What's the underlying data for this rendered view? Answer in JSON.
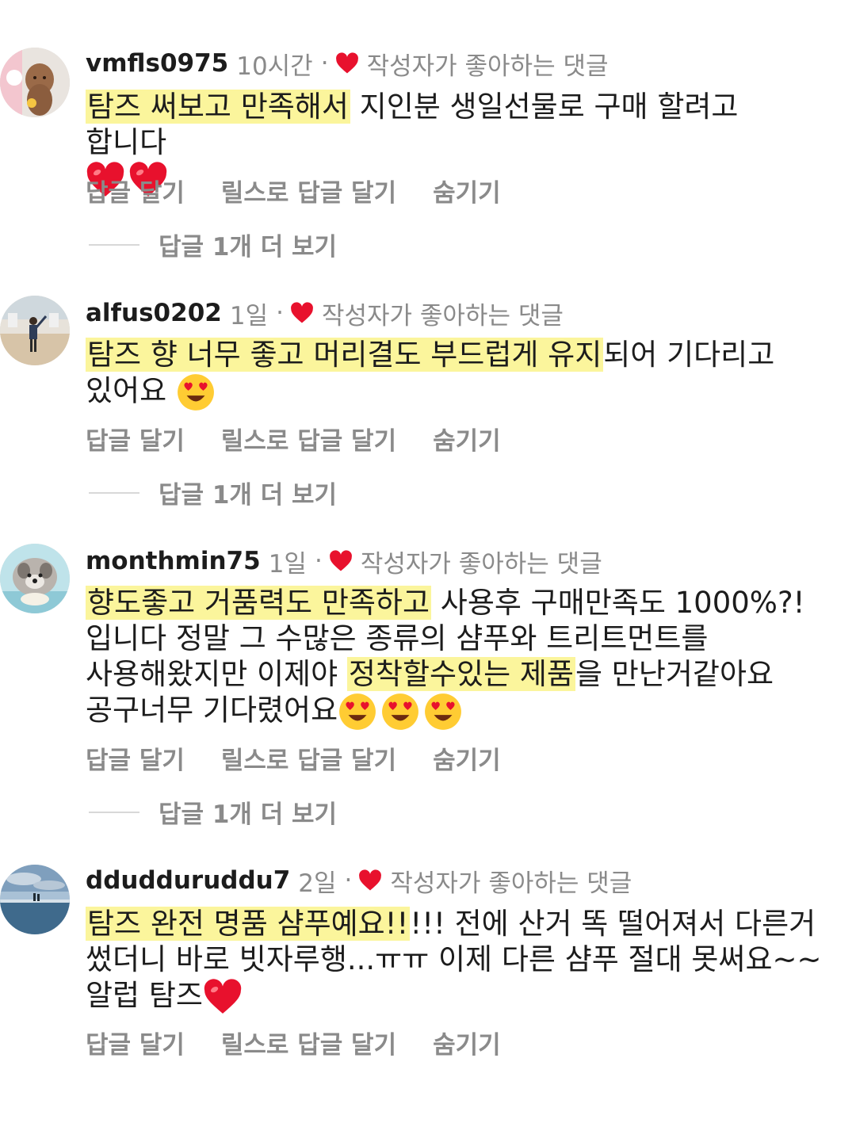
{
  "liked_label": "작성자가 좋아하는 댓글",
  "action_labels": {
    "reply": "답글 달기",
    "reels_reply": "릴스로 답글 달기",
    "hide": "숨기기"
  },
  "highlight_color": "#fbf59c",
  "heart_color": "#e8112d",
  "comments": [
    {
      "username": "vmfls0975",
      "time": "10시간",
      "avatar_icon": "poodle-photo-avatar",
      "text_highlight": "탐즈 써보고 만족해서",
      "text_rest": " 지인분 생일선물로 구매 할려고 합니다",
      "emoji": [
        "red-heart",
        "red-heart"
      ],
      "more_replies": "답글 1개 더 보기"
    },
    {
      "username": "alfus0202",
      "time": "1일",
      "avatar_icon": "gym-photo-avatar",
      "text_highlight": "탐즈 향 너무 좋고 머리결도 부드럽게 유지",
      "text_rest": "되어 기다리고 있어요",
      "emoji": [
        "heart-eyes"
      ],
      "more_replies": "답글 1개 더 보기"
    },
    {
      "username": "monthmin75",
      "time": "1일",
      "avatar_icon": "dog-photo-avatar",
      "text_highlight": "향도좋고 거품력도 만족하고",
      "text_mid": " 사용후 구매만족도 1000%?!입니다 정말 그 수많은 종류의 샴푸와 트리트먼트를 사용해왔지만 이제야 ",
      "text_highlight2": "정착할수있는 제품",
      "text_rest": "을 만난거같아요 공구너무 기다렸어요",
      "emoji": [
        "heart-eyes",
        "heart-eyes",
        "heart-eyes"
      ],
      "more_replies": "답글 1개 더 보기"
    },
    {
      "username": "ddudduruddu7",
      "time": "2일",
      "avatar_icon": "beach-photo-avatar",
      "text_highlight": "탐즈 완전 명품 샴푸예요!!",
      "text_rest": "!!! 전에 산거 똑 떨어져서 다른거 썼더니 바로 빗자루행...ㅠㅠ 이제 다른 샴푸 절대 못써요~~ 알럽 탐즈",
      "emoji": [
        "red-heart"
      ]
    }
  ]
}
